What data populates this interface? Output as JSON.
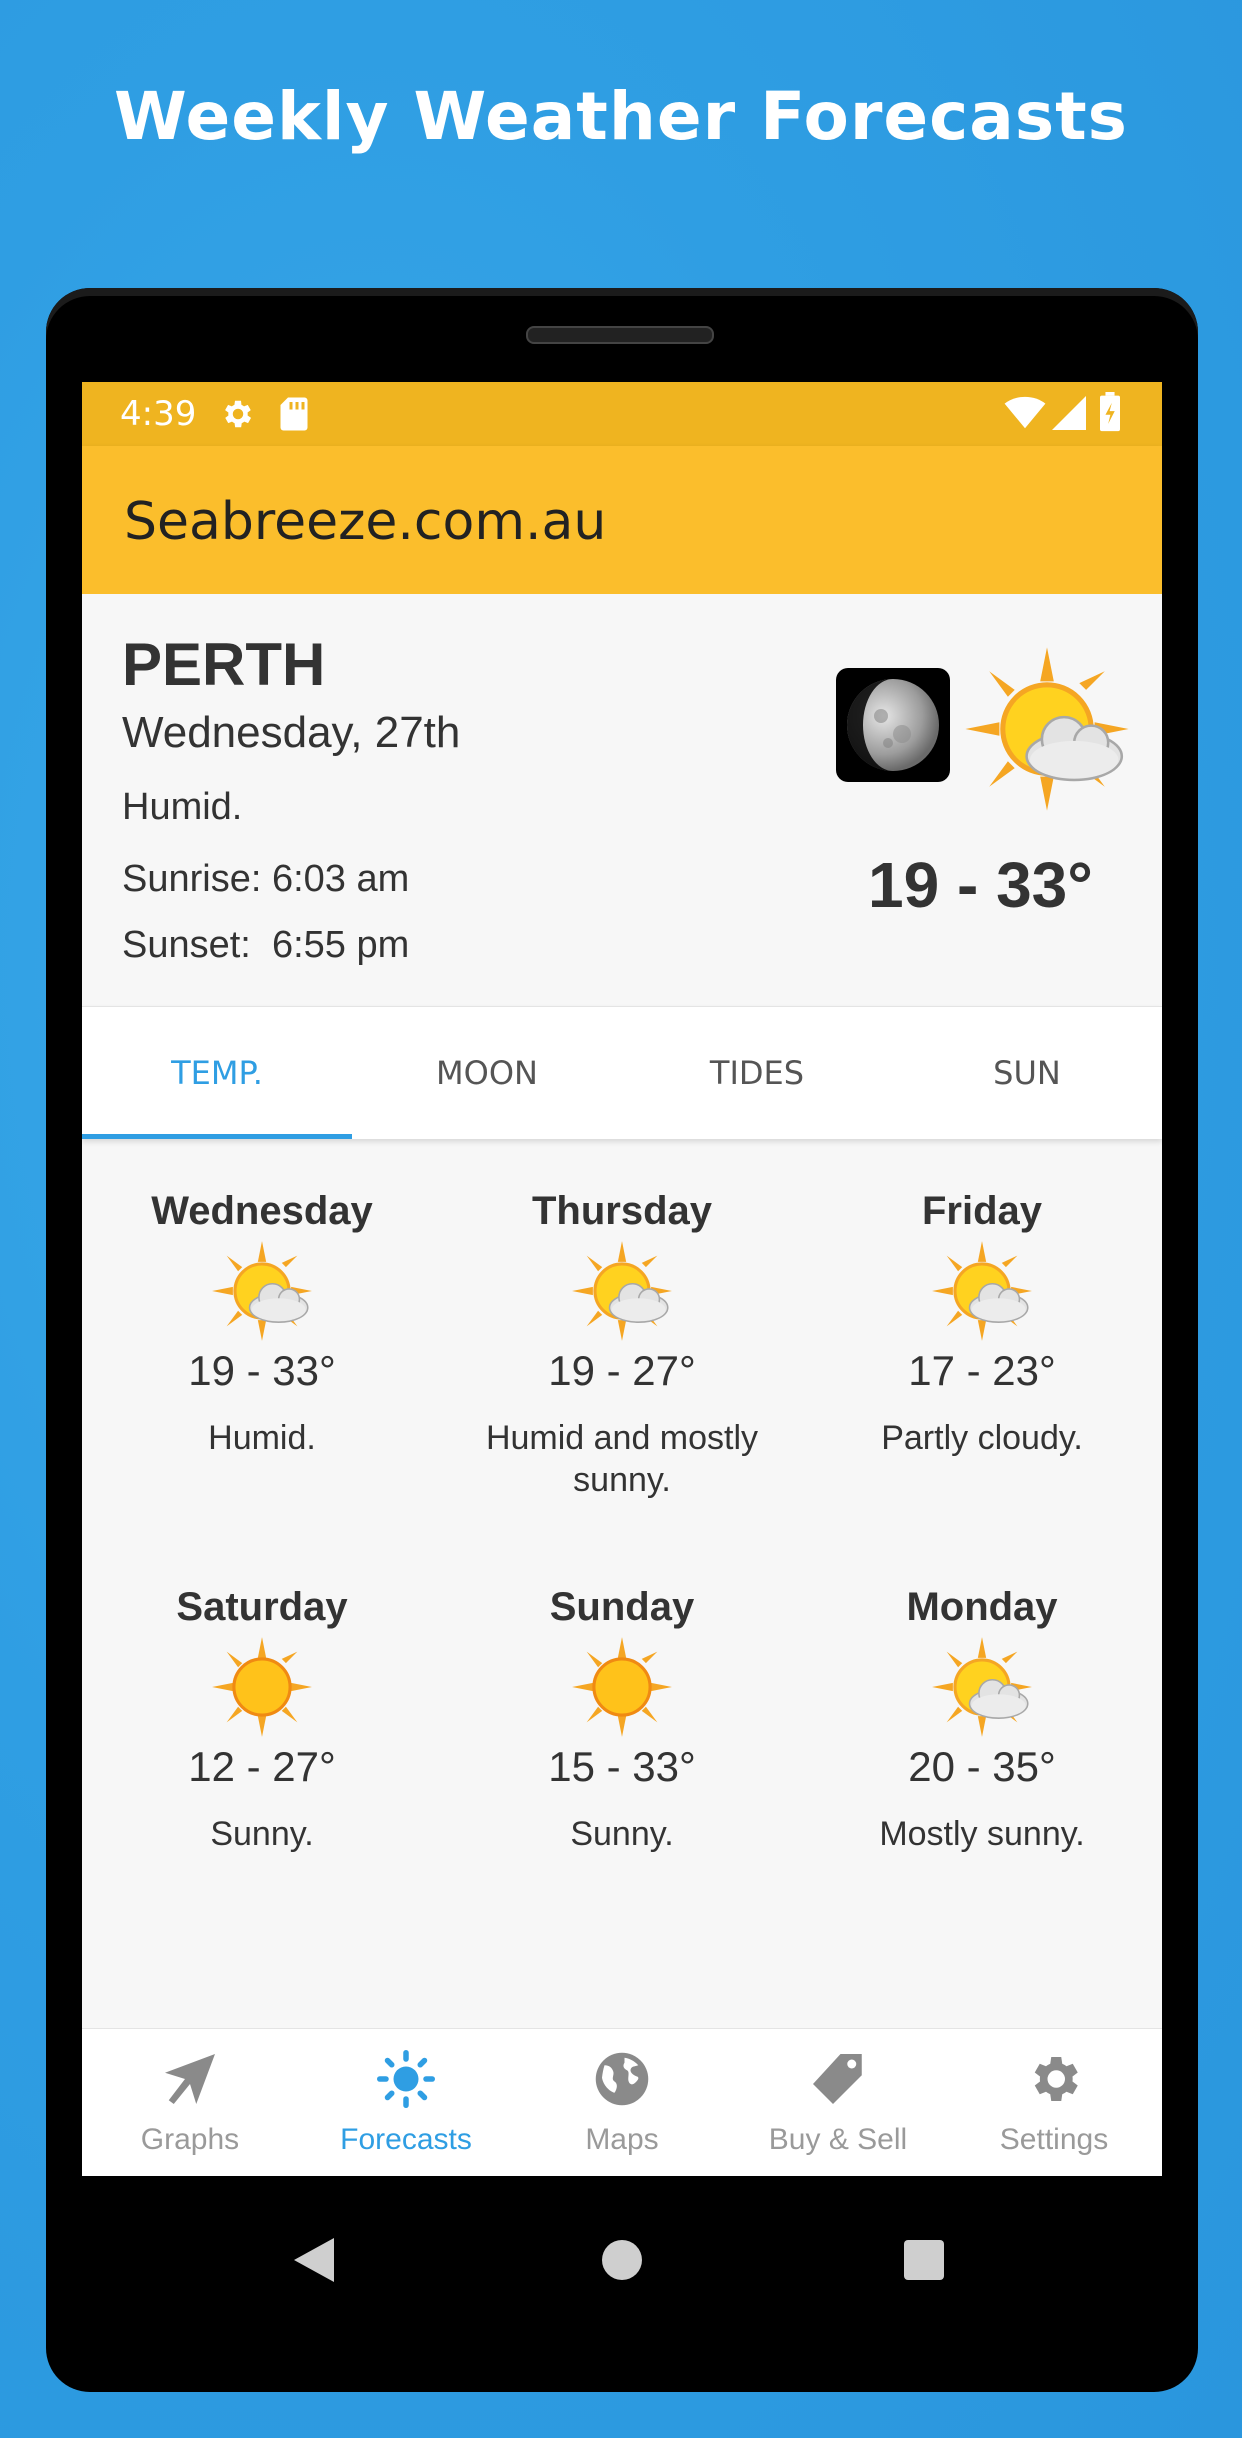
{
  "headline": "Weekly Weather Forecasts",
  "status_bar": {
    "time": "4:39",
    "left_icons": [
      "gear-icon",
      "sd-card-icon"
    ],
    "right_icons": [
      "wifi-icon",
      "signal-icon",
      "battery-icon"
    ]
  },
  "app": {
    "title": "Seabreeze.com.au"
  },
  "summary": {
    "city": "PERTH",
    "date": "Wednesday, 27th",
    "condition": "Humid.",
    "sunrise": "Sunrise: 6:03 am",
    "sunset": "Sunset:  6:55 pm",
    "temp_range": "19 - 33°",
    "icons": [
      "moon-phase-icon",
      "sun-cloud-icon"
    ]
  },
  "tabs": [
    {
      "label": "TEMP.",
      "active": true
    },
    {
      "label": "MOON",
      "active": false
    },
    {
      "label": "TIDES",
      "active": false
    },
    {
      "label": "SUN",
      "active": false
    }
  ],
  "forecast": [
    {
      "day": "Wednesday",
      "icon": "sun-cloud-icon",
      "range": "19 - 33°",
      "desc": "Humid."
    },
    {
      "day": "Thursday",
      "icon": "sun-cloud-icon",
      "range": "19 - 27°",
      "desc": "Humid and mostly sunny."
    },
    {
      "day": "Friday",
      "icon": "sun-cloud-icon",
      "range": "17 - 23°",
      "desc": "Partly cloudy."
    },
    {
      "day": "Saturday",
      "icon": "sun-icon",
      "range": "12 - 27°",
      "desc": "Sunny."
    },
    {
      "day": "Sunday",
      "icon": "sun-icon",
      "range": "15 - 33°",
      "desc": "Sunny."
    },
    {
      "day": "Monday",
      "icon": "sun-cloud-icon",
      "range": "20 - 35°",
      "desc": "Mostly sunny."
    }
  ],
  "bottom_nav": [
    {
      "label": "Graphs",
      "icon": "graphs-arrow-icon",
      "active": false
    },
    {
      "label": "Forecasts",
      "icon": "sun-icon",
      "active": true
    },
    {
      "label": "Maps",
      "icon": "globe-icon",
      "active": false
    },
    {
      "label": "Buy & Sell",
      "icon": "tag-icon",
      "active": false
    },
    {
      "label": "Settings",
      "icon": "gear-icon",
      "active": false
    }
  ],
  "system_nav": [
    "back-icon",
    "home-icon",
    "recents-icon"
  ],
  "colors": {
    "background": "#2f9ee3",
    "status_bar": "#efb420",
    "app_bar": "#fbbe2c",
    "accent": "#2f9ee3",
    "inactive_nav": "#9a9a9a"
  }
}
